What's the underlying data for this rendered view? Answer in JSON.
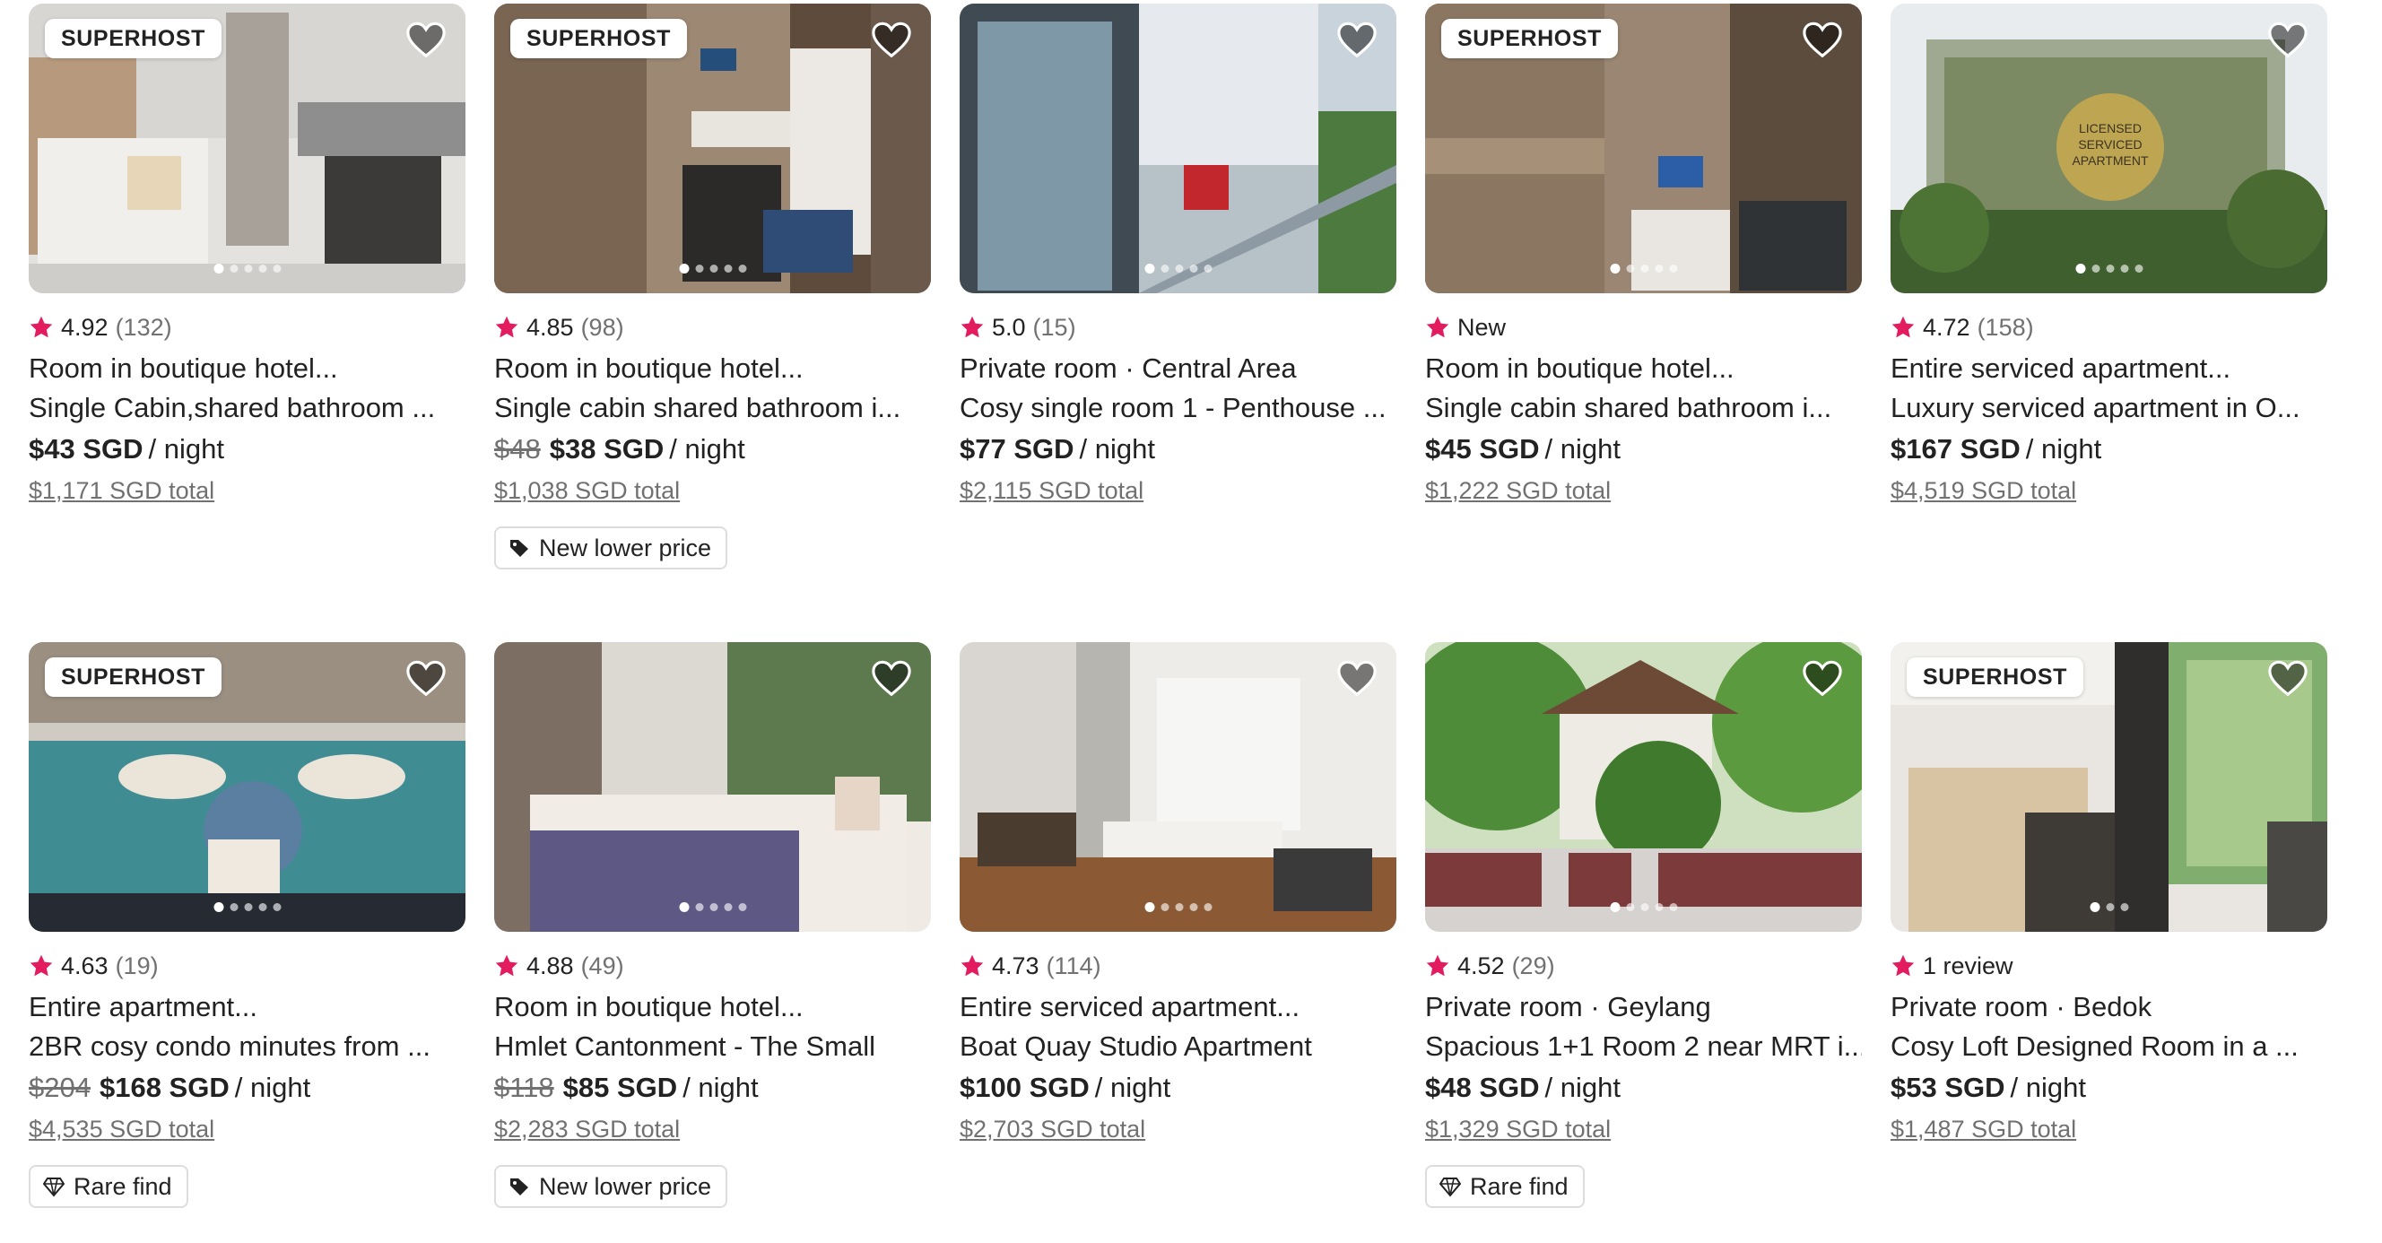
{
  "colors": {
    "accent": "#E31C5F",
    "text": "#222222",
    "muted": "#717171",
    "border": "#DDDDDD"
  },
  "listings": [
    {
      "badge": "SUPERHOST",
      "rating": "4.92",
      "reviews": "(132)",
      "title": "Room in boutique hotel...",
      "subtitle": "Single Cabin,shared bathroom ...",
      "old_price": "",
      "price": "$43 SGD",
      "per": "/ night",
      "total": "$1,171 SGD total",
      "tag": "",
      "tag_icon": ""
    },
    {
      "badge": "SUPERHOST",
      "rating": "4.85",
      "reviews": "(98)",
      "title": "Room in boutique hotel...",
      "subtitle": "Single cabin shared bathroom i...",
      "old_price": "$48",
      "price": "$38 SGD",
      "per": "/ night",
      "total": "$1,038 SGD total",
      "tag": "New lower price",
      "tag_icon": "price-tag-icon"
    },
    {
      "badge": "",
      "rating": "5.0",
      "reviews": "(15)",
      "title": "Private room · Central Area",
      "subtitle": "Cosy single room 1 - Penthouse ...",
      "old_price": "",
      "price": "$77 SGD",
      "per": "/ night",
      "total": "$2,115 SGD total",
      "tag": "",
      "tag_icon": ""
    },
    {
      "badge": "SUPERHOST",
      "rating": "New",
      "reviews": "",
      "title": "Room in boutique hotel...",
      "subtitle": "Single cabin shared bathroom i...",
      "old_price": "",
      "price": "$45 SGD",
      "per": "/ night",
      "total": "$1,222 SGD total",
      "tag": "",
      "tag_icon": ""
    },
    {
      "badge": "",
      "rating": "4.72",
      "reviews": "(158)",
      "title": "Entire serviced apartment...",
      "subtitle": "Luxury serviced apartment in O...",
      "old_price": "",
      "price": "$167 SGD",
      "per": "/ night",
      "total": "$4,519 SGD total",
      "tag": "",
      "tag_icon": "",
      "photo_text": [
        "LICENSED",
        "SERVICED",
        "APARTMENT"
      ]
    },
    {
      "badge": "SUPERHOST",
      "rating": "4.63",
      "reviews": "(19)",
      "title": "Entire apartment...",
      "subtitle": "2BR cosy condo minutes from ...",
      "old_price": "$204",
      "price": "$168 SGD",
      "per": "/ night",
      "total": "$4,535 SGD total",
      "tag": "Rare find",
      "tag_icon": "diamond-icon"
    },
    {
      "badge": "",
      "rating": "4.88",
      "reviews": "(49)",
      "title": "Room in boutique hotel...",
      "subtitle": "Hmlet Cantonment - The Small",
      "old_price": "$118",
      "price": "$85 SGD",
      "per": "/ night",
      "total": "$2,283 SGD total",
      "tag": "New lower price",
      "tag_icon": "price-tag-icon"
    },
    {
      "badge": "",
      "rating": "4.73",
      "reviews": "(114)",
      "title": "Entire serviced apartment...",
      "subtitle": "Boat Quay Studio Apartment",
      "old_price": "",
      "price": "$100 SGD",
      "per": "/ night",
      "total": "$2,703 SGD total",
      "tag": "",
      "tag_icon": ""
    },
    {
      "badge": "",
      "rating": "4.52",
      "reviews": "(29)",
      "title": "Private room · Geylang",
      "subtitle": "Spacious 1+1 Room 2 near MRT i...",
      "old_price": "",
      "price": "$48 SGD",
      "per": "/ night",
      "total": "$1,329 SGD total",
      "tag": "Rare find",
      "tag_icon": "diamond-icon"
    },
    {
      "badge": "SUPERHOST",
      "rating": "1 review",
      "reviews": "",
      "title": "Private room · Bedok",
      "subtitle": "Cosy Loft Designed Room in a ...",
      "old_price": "",
      "price": "$53 SGD",
      "per": "/ night",
      "total": "$1,487 SGD total",
      "tag": "",
      "tag_icon": ""
    }
  ]
}
